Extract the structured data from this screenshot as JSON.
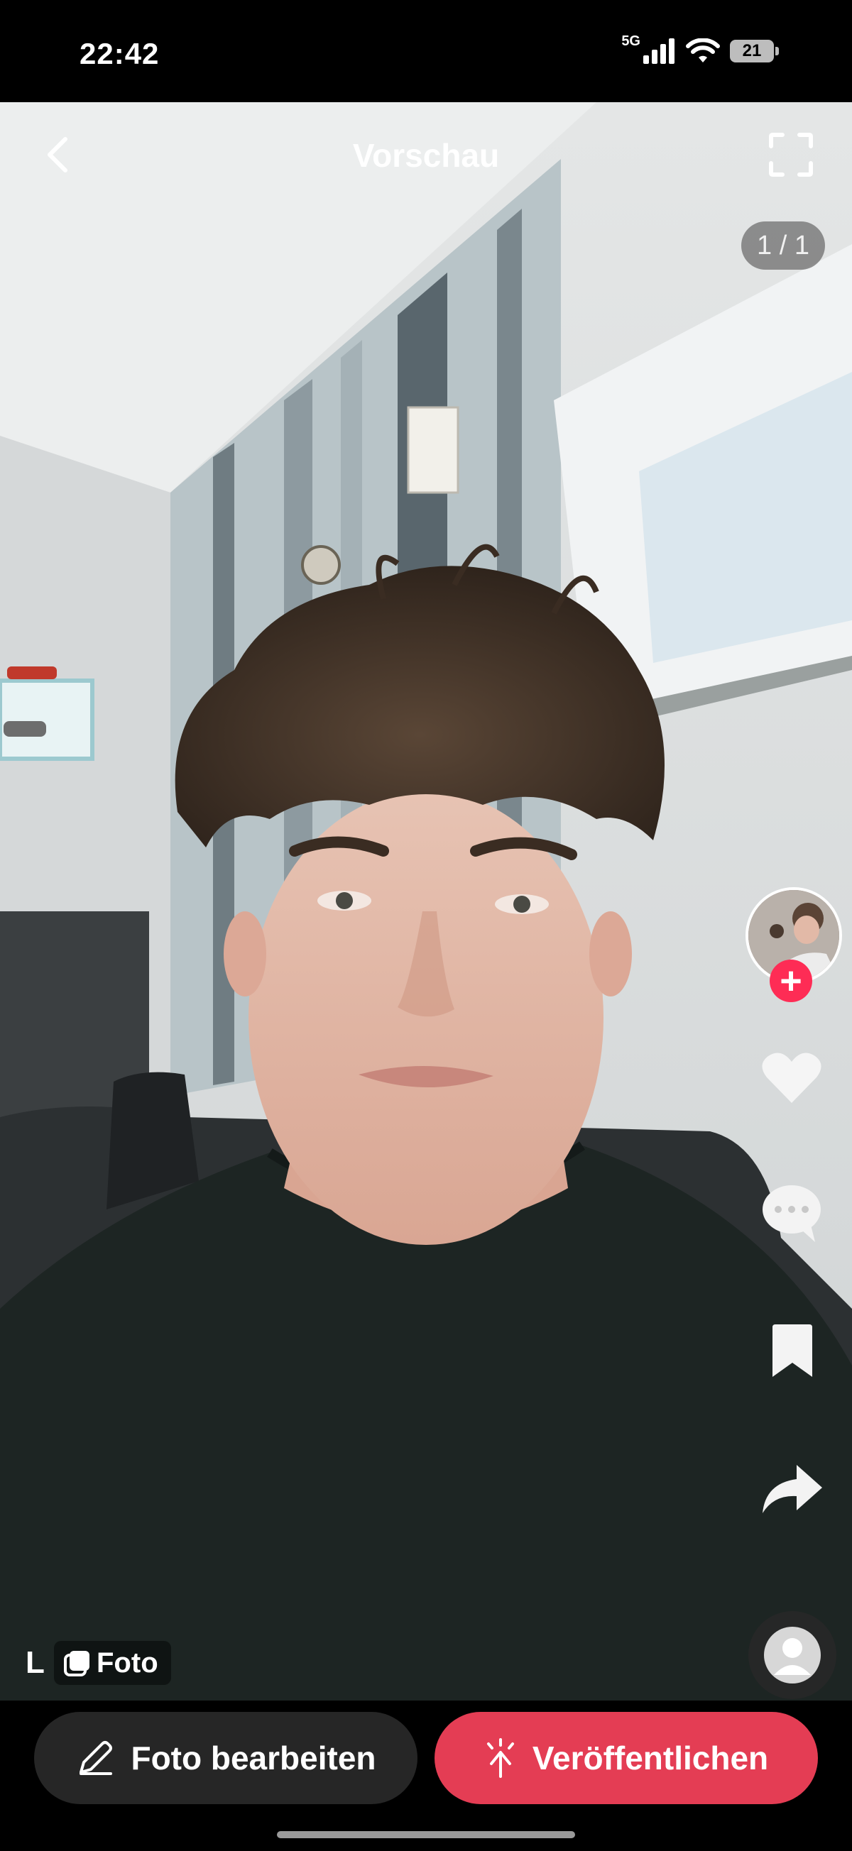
{
  "status_bar": {
    "time": "22:42",
    "network": "5G",
    "battery": "21",
    "icons": [
      "signal-icon",
      "wifi-icon",
      "battery-icon"
    ]
  },
  "header": {
    "title": "Vorschau",
    "back_icon": "chevron-left-icon",
    "fullscreen_icon": "fullscreen-icon"
  },
  "page_indicator": "1 / 1",
  "right_rail": {
    "follow_symbol": "+",
    "icons": [
      "heart-icon",
      "comment-icon",
      "bookmark-icon",
      "share-icon",
      "sound-icon"
    ]
  },
  "bottom_left": {
    "label_l": "L",
    "photo_tag": "Foto"
  },
  "actions": {
    "edit_label": "Foto bearbeiten",
    "publish_label": "Veröffentlichen"
  },
  "colors": {
    "accent": "#fe2c55",
    "publish": "#e43d54",
    "edit_bg": "#262626"
  }
}
